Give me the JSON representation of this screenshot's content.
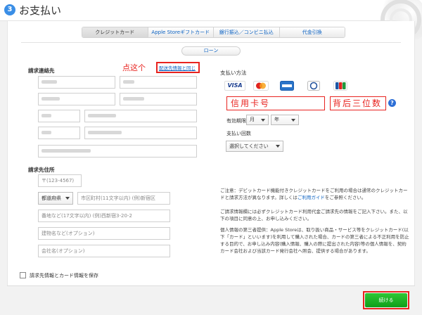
{
  "header": {
    "step_number": "3",
    "title": "お支払い"
  },
  "tabs": [
    {
      "label": "クレジットカード",
      "active": true
    },
    {
      "label": "Apple Storeギフトカード",
      "active": false
    },
    {
      "label": "銀行振込／コンビニ払込",
      "active": false
    },
    {
      "label": "代金引換",
      "active": false
    }
  ],
  "loan_button": "ローン",
  "billing": {
    "contact_heading": "請求連絡先",
    "same_as_shipping_link": "配送先情報と同じ",
    "address_heading": "請求先住所",
    "postal_code_placeholder": "〒(123-4567)",
    "prefecture_value": "都道府県",
    "city_placeholder": "市区町村(11文字以内) (例)新宿区",
    "street_placeholder": "番地など(17文字以内) (例)西新宿3-20-2",
    "building_placeholder": "建物名など(オプション)",
    "company_placeholder": "会社名(オプション)"
  },
  "payment": {
    "heading": "支払い方法",
    "cards": [
      "VISA",
      "MC",
      "AMEX",
      "DC",
      "JCB"
    ],
    "expiry_label": "有効期限",
    "month_value": "月",
    "year_value": "年",
    "installments_label": "支払い回数",
    "installments_value": "選択してください"
  },
  "annotations": {
    "click_here": "点这个",
    "card_number": "信用卡号",
    "cvv": "背后三位数"
  },
  "notes": {
    "debit_pre": "ご注意：デビットカード機能付きクレジットカードをご利用の場合は通常のクレジットカードと請求方法が異なります。詳しくは",
    "debit_link": "ご利用ガイド",
    "debit_post": "をご参照ください。",
    "consent": "ご請求情報欄には必ずクレジットカード利用代金ご請求先の情報をご記入下さい。また、以下の項目に同意の上、お申し込みください。",
    "third_party": "個人情報の第三者提供：Apple Storeは、取り扱い商品・サービス等をクレジットカード(以下「カード」といいます)を利用して購入された場合、カードの第三者による不正利用を防止する目的で、お申し込み内容(購入情報、購入の際に提出された内容)等の個人情報を、契約カード会社および当該カード発行会社へ照会、提供する場合があります。"
  },
  "save_checkbox_label": "請求先情報とカード情報を保存",
  "continue_button": "続ける",
  "colors": {
    "accent_blue": "#0c62c2",
    "annotation_red": "#e8231f",
    "continue_green": "#1aa824"
  }
}
